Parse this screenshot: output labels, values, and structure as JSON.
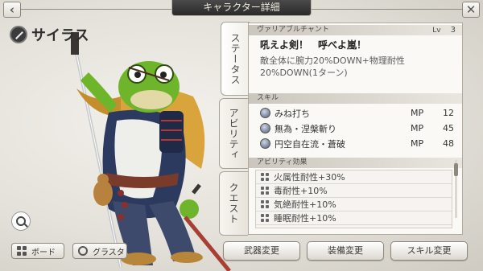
{
  "header": {
    "title": "キャラクター詳細",
    "back_icon": "chevron-left-icon",
    "close_icon": "close-icon"
  },
  "character": {
    "name": "サイラス",
    "emblem_icon": "sword-emblem-icon"
  },
  "tabs": [
    {
      "label": "ステータス",
      "active": true
    },
    {
      "label": "アビリティ",
      "active": false
    },
    {
      "label": "クエスト",
      "active": false
    }
  ],
  "variable_chant": {
    "header": "ヴァリアブルチャント",
    "level_label": "Lv",
    "level_value": "3",
    "title": "吼えよ剣！　呼べよ嵐！",
    "description": "敵全体に腕力20%DOWN+物理耐性20%DOWN(1ターン)"
  },
  "skills": {
    "header": "スキル",
    "items": [
      {
        "name": "みね打ち",
        "mp_label": "MP",
        "cost": "12"
      },
      {
        "name": "無為・涅槃斬り",
        "mp_label": "MP",
        "cost": "45"
      },
      {
        "name": "円空自在流・蒼破",
        "mp_label": "MP",
        "cost": "48"
      }
    ]
  },
  "ability_effects": {
    "header": "アビリティ効果",
    "items": [
      {
        "text": "火属性耐性+30%"
      },
      {
        "text": "毒耐性+10%"
      },
      {
        "text": "気絶耐性+10%"
      },
      {
        "text": "睡眠耐性+10%"
      }
    ]
  },
  "bottom": {
    "board_label": "ボード",
    "grasta_label": "グラスタ",
    "weapon_change": "武器変更",
    "equip_change": "装備変更",
    "skill_change": "スキル変更",
    "zoom_icon": "magnifier-icon"
  },
  "colors": {
    "frog_green": "#6fb52c",
    "armor_navy": "#2b3a5e",
    "scarf_gold": "#d9a43b",
    "panel_bg": "#faf9f6"
  }
}
